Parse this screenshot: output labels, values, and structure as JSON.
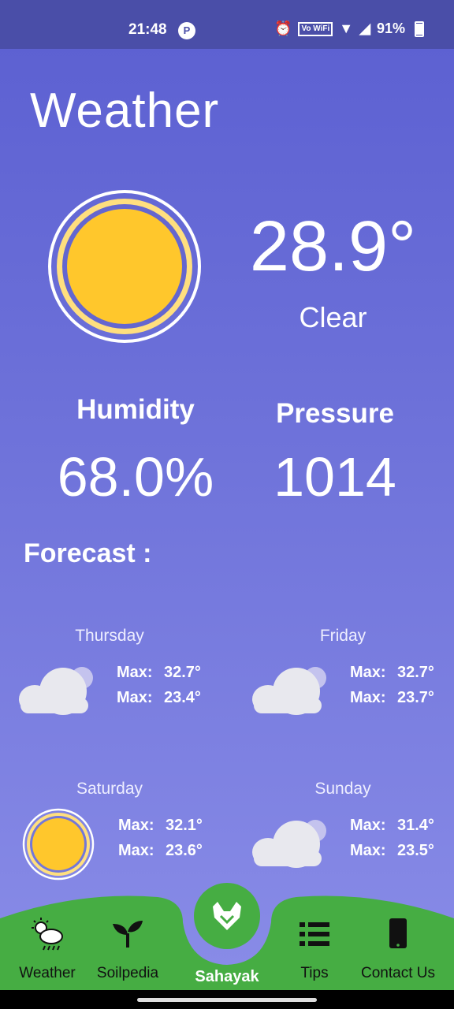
{
  "status_bar": {
    "time": "21:48",
    "battery": "91%",
    "vowifi": "Vo WiFi"
  },
  "page_title": "Weather",
  "current": {
    "temperature": "28.9°",
    "condition": "Clear",
    "icon": "sun-icon"
  },
  "stats": {
    "humidity_label": "Humidity",
    "humidity_value": "68.0%",
    "pressure_label": "Pressure",
    "pressure_value": "1014"
  },
  "forecast_heading": "Forecast :",
  "forecast": [
    {
      "day": "Thursday",
      "icon": "cloud-icon",
      "max_label": "Max:",
      "max": "32.7°",
      "min_label": "Max:",
      "min": "23.4°"
    },
    {
      "day": "Friday",
      "icon": "cloud-icon",
      "max_label": "Max:",
      "max": "32.7°",
      "min_label": "Max:",
      "min": "23.7°"
    },
    {
      "day": "Saturday",
      "icon": "sun-icon",
      "max_label": "Max:",
      "max": "32.1°",
      "min_label": "Max:",
      "min": "23.6°"
    },
    {
      "day": "Sunday",
      "icon": "cloud-icon",
      "max_label": "Max:",
      "max": "31.4°",
      "min_label": "Max:",
      "min": "23.5°"
    }
  ],
  "nav": {
    "weather": "Weather",
    "soilpedia": "Soilpedia",
    "sahayak": "Sahayak",
    "tips": "Tips",
    "contact": "Contact Us"
  },
  "colors": {
    "background_top": "#5b5fd1",
    "background_bottom": "#8a8de8",
    "nav_green": "#46ad43",
    "sun_yellow": "#ffc72c"
  }
}
